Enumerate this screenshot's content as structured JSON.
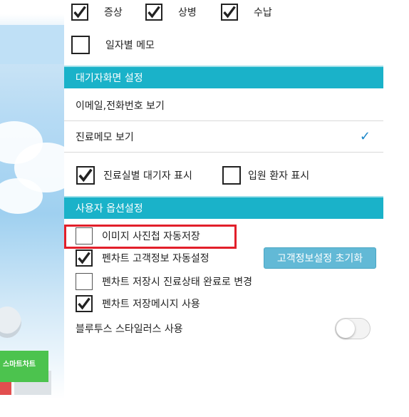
{
  "top_checks": [
    {
      "label": "증상",
      "checked": true
    },
    {
      "label": "상병",
      "checked": true
    },
    {
      "label": "수납",
      "checked": true
    }
  ],
  "daily_memo": {
    "label": "일자별 메모",
    "checked": false
  },
  "waiting_section": {
    "title": "대기자화면 설정",
    "rows": [
      {
        "label": "이메일,전화번호 보기",
        "checked": false
      },
      {
        "label": "진료메모 보기",
        "checked": true
      }
    ],
    "checks": [
      {
        "label": "진료실별 대기자 표시",
        "checked": true
      },
      {
        "label": "입원 환자 표시",
        "checked": false
      }
    ]
  },
  "user_section": {
    "title": "사용자 옵션설정",
    "options": [
      {
        "label": "이미지 사진첩 자동저장",
        "checked": false
      },
      {
        "label": "펜차트 고객정보 자동설정",
        "checked": true
      },
      {
        "label": "펜차트 저장시 진료상태 완료로 변경",
        "checked": false
      },
      {
        "label": "펜차트 저장메시지 사용",
        "checked": true
      }
    ],
    "reset_button": "고객정보설정 초기화",
    "bluetooth": {
      "label": "블루투스 스타일러스 사용",
      "on": false
    }
  },
  "background": {
    "badge": "스마트차트"
  },
  "colors": {
    "section_header": "#1ab2c9",
    "highlight": "#e21f2a",
    "button": "#62b9d6",
    "tick": "#1a86c9"
  }
}
